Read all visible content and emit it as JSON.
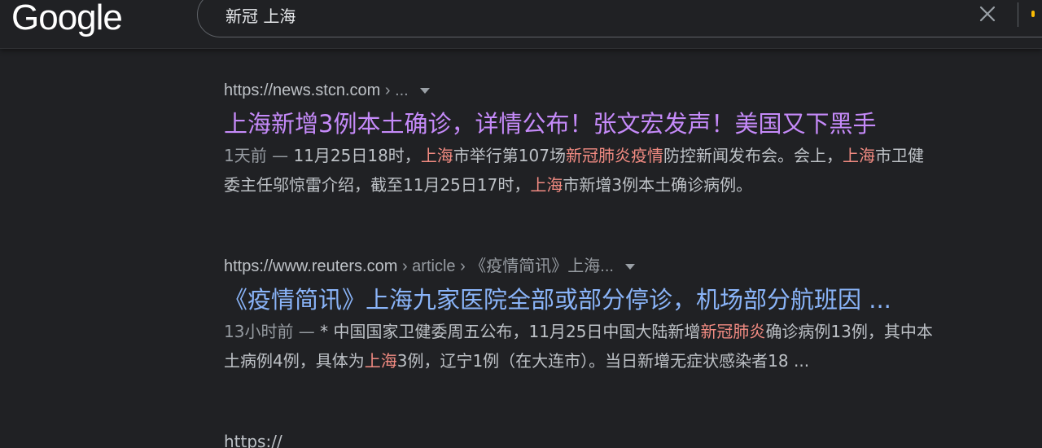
{
  "header": {
    "logo": "Google",
    "search_value": "新冠 上海"
  },
  "results": [
    {
      "cite_domain": "https://news.stcn.com",
      "cite_path": " › ...",
      "title": "上海新增3例本土确诊，详情公布！张文宏发声！美国又下黑手",
      "title_state": "visited",
      "snippet_line1": [
        {
          "t": "1天前 — ",
          "c": "date"
        },
        {
          "t": "11月25日18时，",
          "c": ""
        },
        {
          "t": "上海",
          "c": "hl"
        },
        {
          "t": "市举行第107场",
          "c": ""
        },
        {
          "t": "新冠肺炎疫情",
          "c": "hl"
        },
        {
          "t": "防控新闻发布会。会上，",
          "c": ""
        },
        {
          "t": "上海",
          "c": "hl"
        },
        {
          "t": "市卫健",
          "c": ""
        }
      ],
      "snippet_line2": [
        {
          "t": "委主任邬惊雷介绍，截至11月25日17时，",
          "c": ""
        },
        {
          "t": "上海",
          "c": "hl"
        },
        {
          "t": "市新增3例本土确诊病例。",
          "c": ""
        }
      ]
    },
    {
      "cite_domain": "https://www.reuters.com",
      "cite_path": " › article › 《疫情简讯》上海...",
      "title": "《疫情简讯》上海九家医院全部或部分停诊，机场部分航班因 ...",
      "title_state": "link",
      "snippet_line1": [
        {
          "t": "13小时前 — ",
          "c": "date"
        },
        {
          "t": "* 中国国家卫健委周五公布，11月25日中国大陆新增",
          "c": ""
        },
        {
          "t": "新冠肺炎",
          "c": "hl"
        },
        {
          "t": "确诊病例13例，其中本",
          "c": ""
        }
      ],
      "snippet_line2": [
        {
          "t": "土病例4例，具体为",
          "c": ""
        },
        {
          "t": "上海",
          "c": "hl"
        },
        {
          "t": "3例，辽宁1例（在大连市）。当日新增无症状感染者18 ...",
          "c": ""
        }
      ]
    }
  ],
  "partial_next_cite": "https://",
  "colors": {
    "background": "#202124",
    "visited_title": "#c58af9",
    "link_title": "#8ab4f8",
    "highlight": "#f28b82",
    "text": "#bdc1c6"
  }
}
